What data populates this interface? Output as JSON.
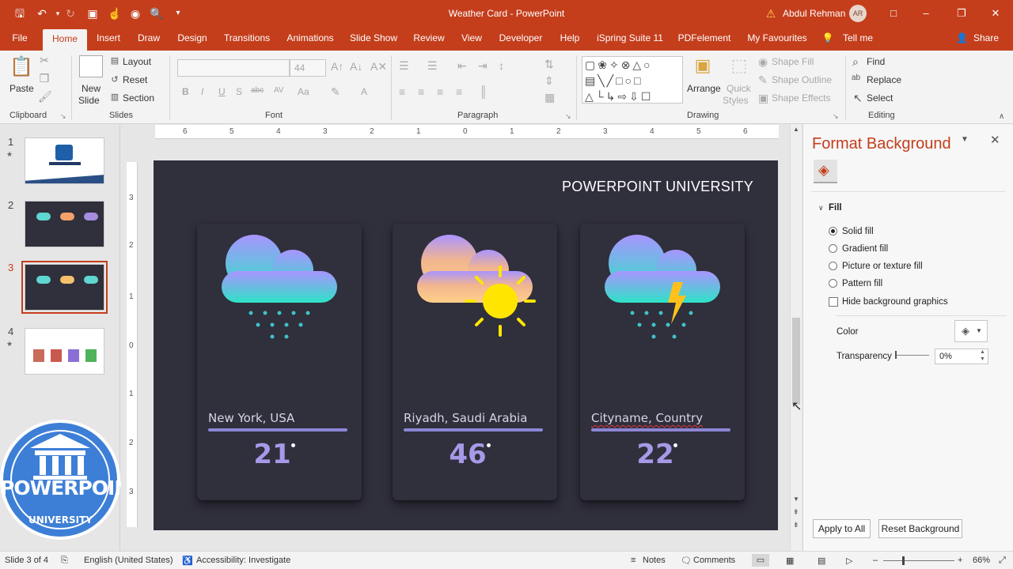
{
  "titlebar": {
    "title": "Weather Card  -  PowerPoint",
    "user": "Abdul Rehman",
    "avatar_initials": "AR",
    "warning_icon": "warning-icon"
  },
  "tabs": [
    "File",
    "Home",
    "Insert",
    "Draw",
    "Design",
    "Transitions",
    "Animations",
    "Slide Show",
    "Review",
    "View",
    "Developer",
    "Help",
    "iSpring Suite 11",
    "PDFelement",
    "My Favourites",
    "Tell me",
    "Share"
  ],
  "active_tab": "Home",
  "ribbon": {
    "clipboard": {
      "label": "Clipboard",
      "paste": "Paste"
    },
    "slides": {
      "label": "Slides",
      "new_slide": "New",
      "new_slide2": "Slide",
      "layout": "Layout",
      "reset": "Reset",
      "section": "Section"
    },
    "font": {
      "label": "Font",
      "size": "44",
      "bold": "B",
      "italic": "I",
      "underline": "U",
      "shadow": "S",
      "strike": "abc",
      "spacing": "AV",
      "case": "Aa",
      "color": "A"
    },
    "paragraph": {
      "label": "Paragraph"
    },
    "drawing": {
      "label": "Drawing",
      "arrange": "Arrange",
      "quick_styles": "Quick",
      "quick_styles2": "Styles",
      "shape_fill": "Shape Fill",
      "shape_outline": "Shape Outline",
      "shape_effects": "Shape Effects"
    },
    "editing": {
      "label": "Editing",
      "find": "Find",
      "replace": "Replace",
      "select": "Select"
    }
  },
  "thumbnails": [
    {
      "num": "1",
      "star": "★"
    },
    {
      "num": "2",
      "star": ""
    },
    {
      "num": "3",
      "star": ""
    },
    {
      "num": "4",
      "star": "★"
    }
  ],
  "ruler": {
    "h": [
      "6",
      "5",
      "4",
      "3",
      "2",
      "1",
      "0",
      "1",
      "2",
      "3",
      "4",
      "5",
      "6"
    ],
    "v": [
      "3",
      "2",
      "1",
      "0",
      "1",
      "2",
      "3"
    ]
  },
  "slide": {
    "brand": "POWERPOINT UNIVERSITY",
    "cards": [
      {
        "city": "New York, USA",
        "temp": "21",
        "icon": "rain-cloud-icon"
      },
      {
        "city": "Riyadh, Saudi Arabia",
        "temp": "46",
        "icon": "sun-cloud-icon"
      },
      {
        "city": "Cityname, Country",
        "temp": "22",
        "icon": "storm-cloud-icon"
      }
    ]
  },
  "logo": {
    "line1": "POWERPOINT",
    "line2": "UNIVERSITY"
  },
  "format_pane": {
    "title": "Format Background",
    "section": "Fill",
    "options": [
      "Solid fill",
      "Gradient fill",
      "Picture or texture fill",
      "Pattern fill"
    ],
    "selected_option": "Solid fill",
    "hide_graphics": "Hide background graphics",
    "color_label": "Color",
    "transparency_label": "Transparency",
    "transparency_value": "0%",
    "apply_all": "Apply to All",
    "reset_bg": "Reset Background"
  },
  "status": {
    "slide": "Slide 3 of 4",
    "language": "English (United States)",
    "accessibility": "Accessibility: Investigate",
    "notes": "Notes",
    "comments": "Comments",
    "zoom": "66%"
  },
  "colors": {
    "accent": "#c43e1c",
    "slide_bg": "#302f3c",
    "card_bar": "#8b86d6",
    "temp_text": "#a69ae8",
    "sun": "#ffe600"
  }
}
